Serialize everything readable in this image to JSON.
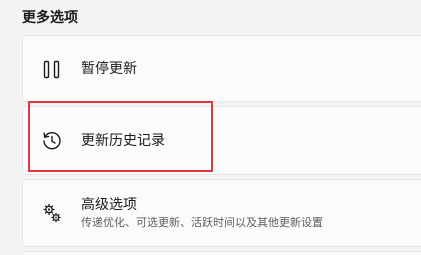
{
  "section": {
    "title": "更多选项"
  },
  "options": [
    {
      "label": "暂停更新",
      "icon": "pause-icon"
    },
    {
      "label": "更新历史记录",
      "icon": "history-icon"
    },
    {
      "label": "高级选项",
      "description": "传递优化、可选更新、活跃时间以及其他更新设置",
      "icon": "gear-cluster-icon"
    }
  ],
  "highlight": {
    "color": "#e0383e"
  }
}
